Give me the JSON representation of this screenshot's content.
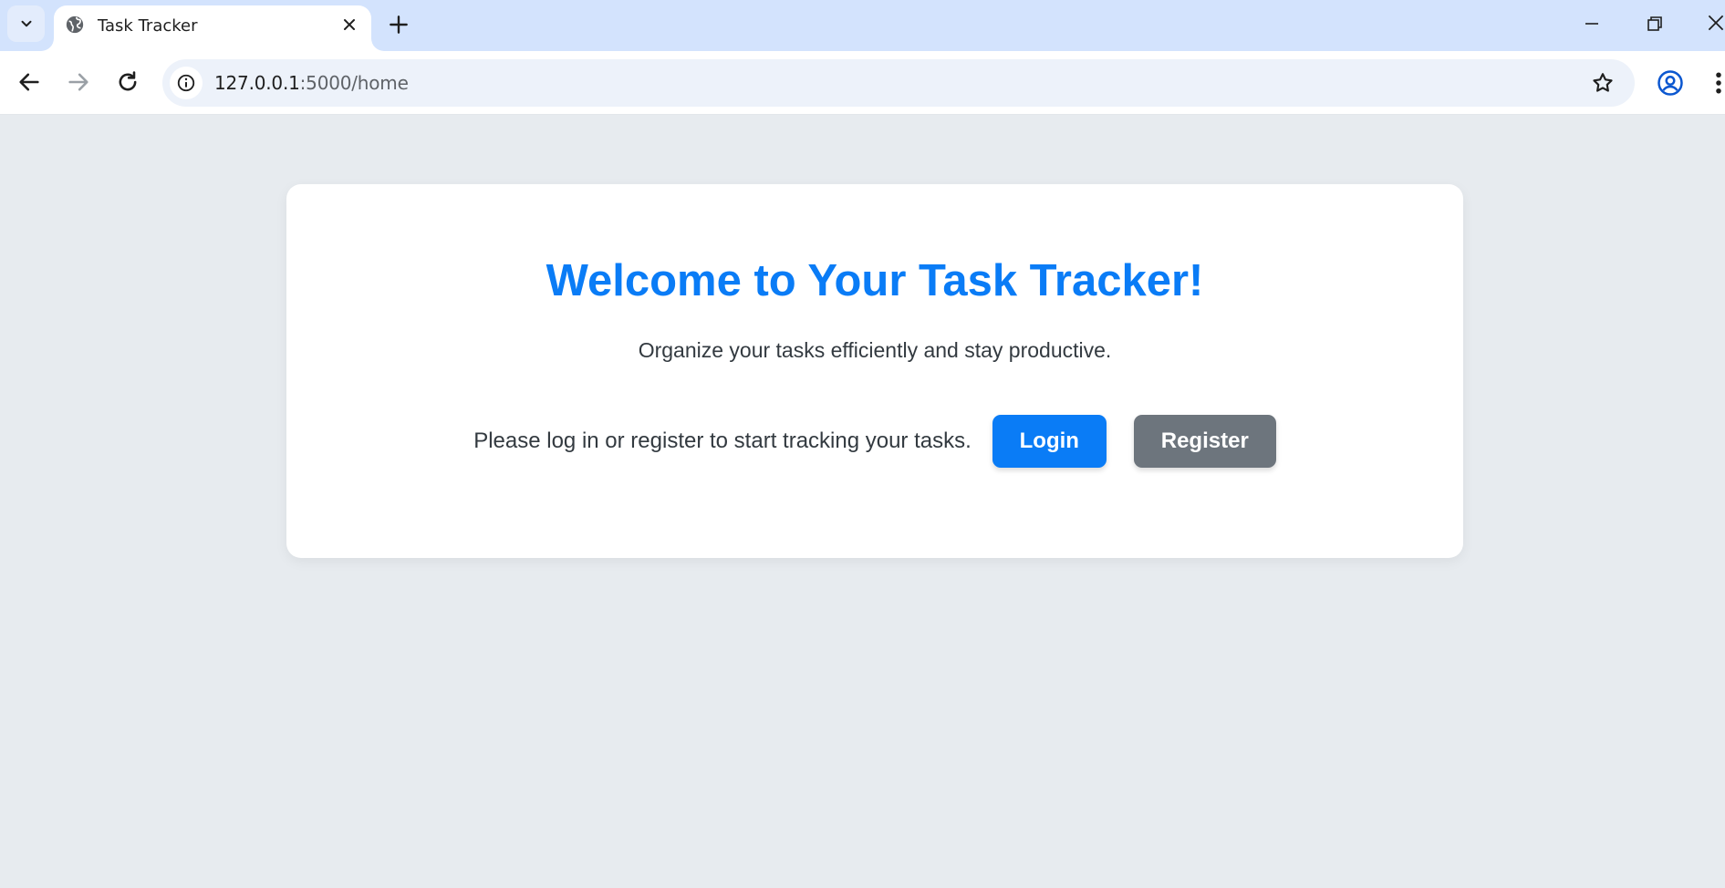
{
  "browser": {
    "tab_title": "Task Tracker",
    "url_host": "127.0.0.1",
    "url_path": ":5000/home"
  },
  "page": {
    "title": "Welcome to Your Task Tracker!",
    "subtitle": "Organize your tasks efficiently and stay productive.",
    "cta_text": "Please log in or register to start tracking your tasks.",
    "login_label": "Login",
    "register_label": "Register"
  },
  "colors": {
    "accent": "#0a7cf6",
    "secondary_button": "#6d757d",
    "page_background": "#e7ebef",
    "tabstrip": "#d3e3fd"
  },
  "icons": [
    "tab-search-icon",
    "globe-icon",
    "close-icon",
    "plus-icon",
    "minimize-icon",
    "restore-icon",
    "back-icon",
    "forward-icon",
    "reload-icon",
    "info-icon",
    "star-icon",
    "profile-icon",
    "more-vert-icon"
  ]
}
